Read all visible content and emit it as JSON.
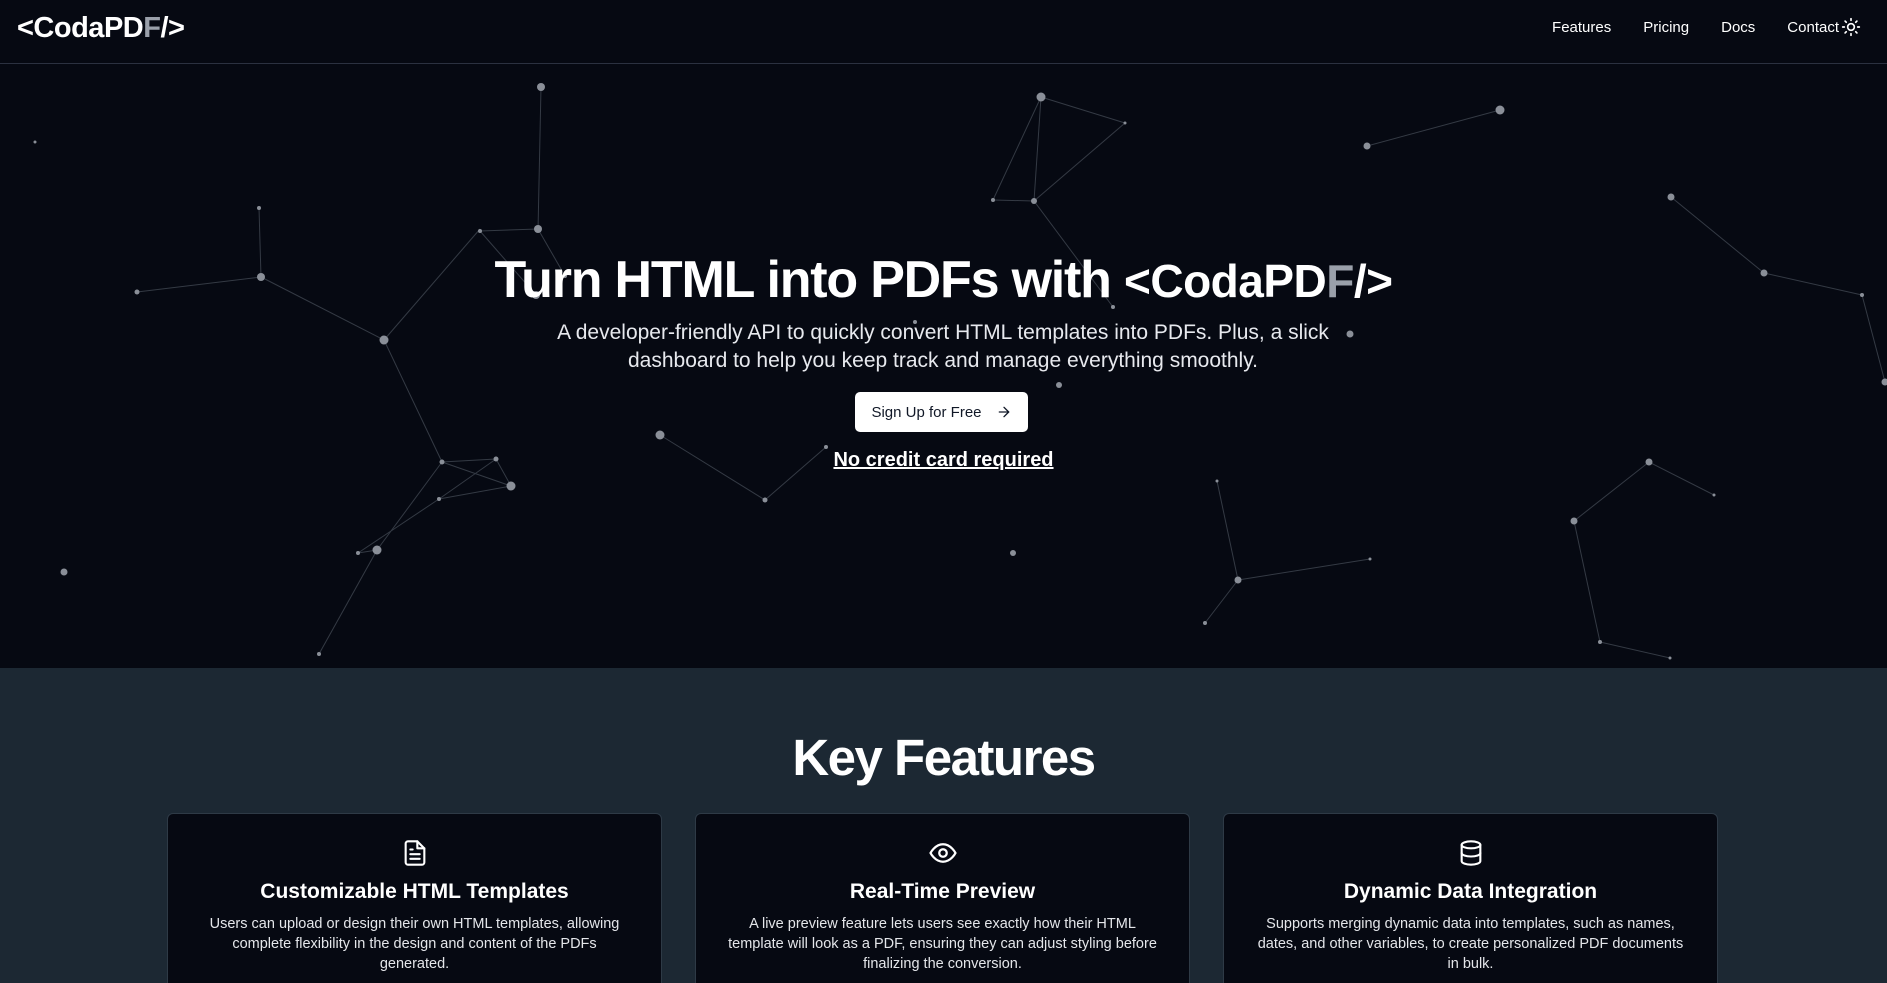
{
  "header": {
    "logo": {
      "open": "<Coda",
      "pdf_part1": "PD",
      "pdf_part2": "F",
      "close": "/>"
    },
    "nav": [
      "Features",
      "Pricing",
      "Docs",
      "Contact"
    ],
    "theme_icon": "sun-icon"
  },
  "hero": {
    "title_prefix": "Turn HTML into PDFs with",
    "brand": {
      "open": "<Coda",
      "pdf_part1": "PD",
      "pdf_part2": "F",
      "close": "/>"
    },
    "subtitle": "A developer-friendly API to quickly convert HTML templates into PDFs. Plus, a slick dashboard to help you keep track and manage everything smoothly.",
    "cta_label": "Sign Up for Free",
    "cta_icon": "arrow-right-icon",
    "note": "No credit card required"
  },
  "features": {
    "title": "Key Features",
    "cards": [
      {
        "icon": "file-text-icon",
        "title": "Customizable HTML Templates",
        "text": "Users can upload or design their own HTML templates, allowing complete flexibility in the design and content of the PDFs generated."
      },
      {
        "icon": "eye-icon",
        "title": "Real-Time Preview",
        "text": "A live preview feature lets users see exactly how their HTML template will look as a PDF, ensuring they can adjust styling before finalizing the conversion."
      },
      {
        "icon": "database-icon",
        "title": "Dynamic Data Integration",
        "text": "Supports merging dynamic data into templates, such as names, dates, and other variables, to create personalized PDF documents in bulk."
      }
    ]
  },
  "colors": {
    "background": "#060912",
    "features_background": "#1c2833",
    "cta_background": "#ffffff",
    "network_lines": "#3a3f48",
    "network_nodes": "#8a8f98"
  }
}
